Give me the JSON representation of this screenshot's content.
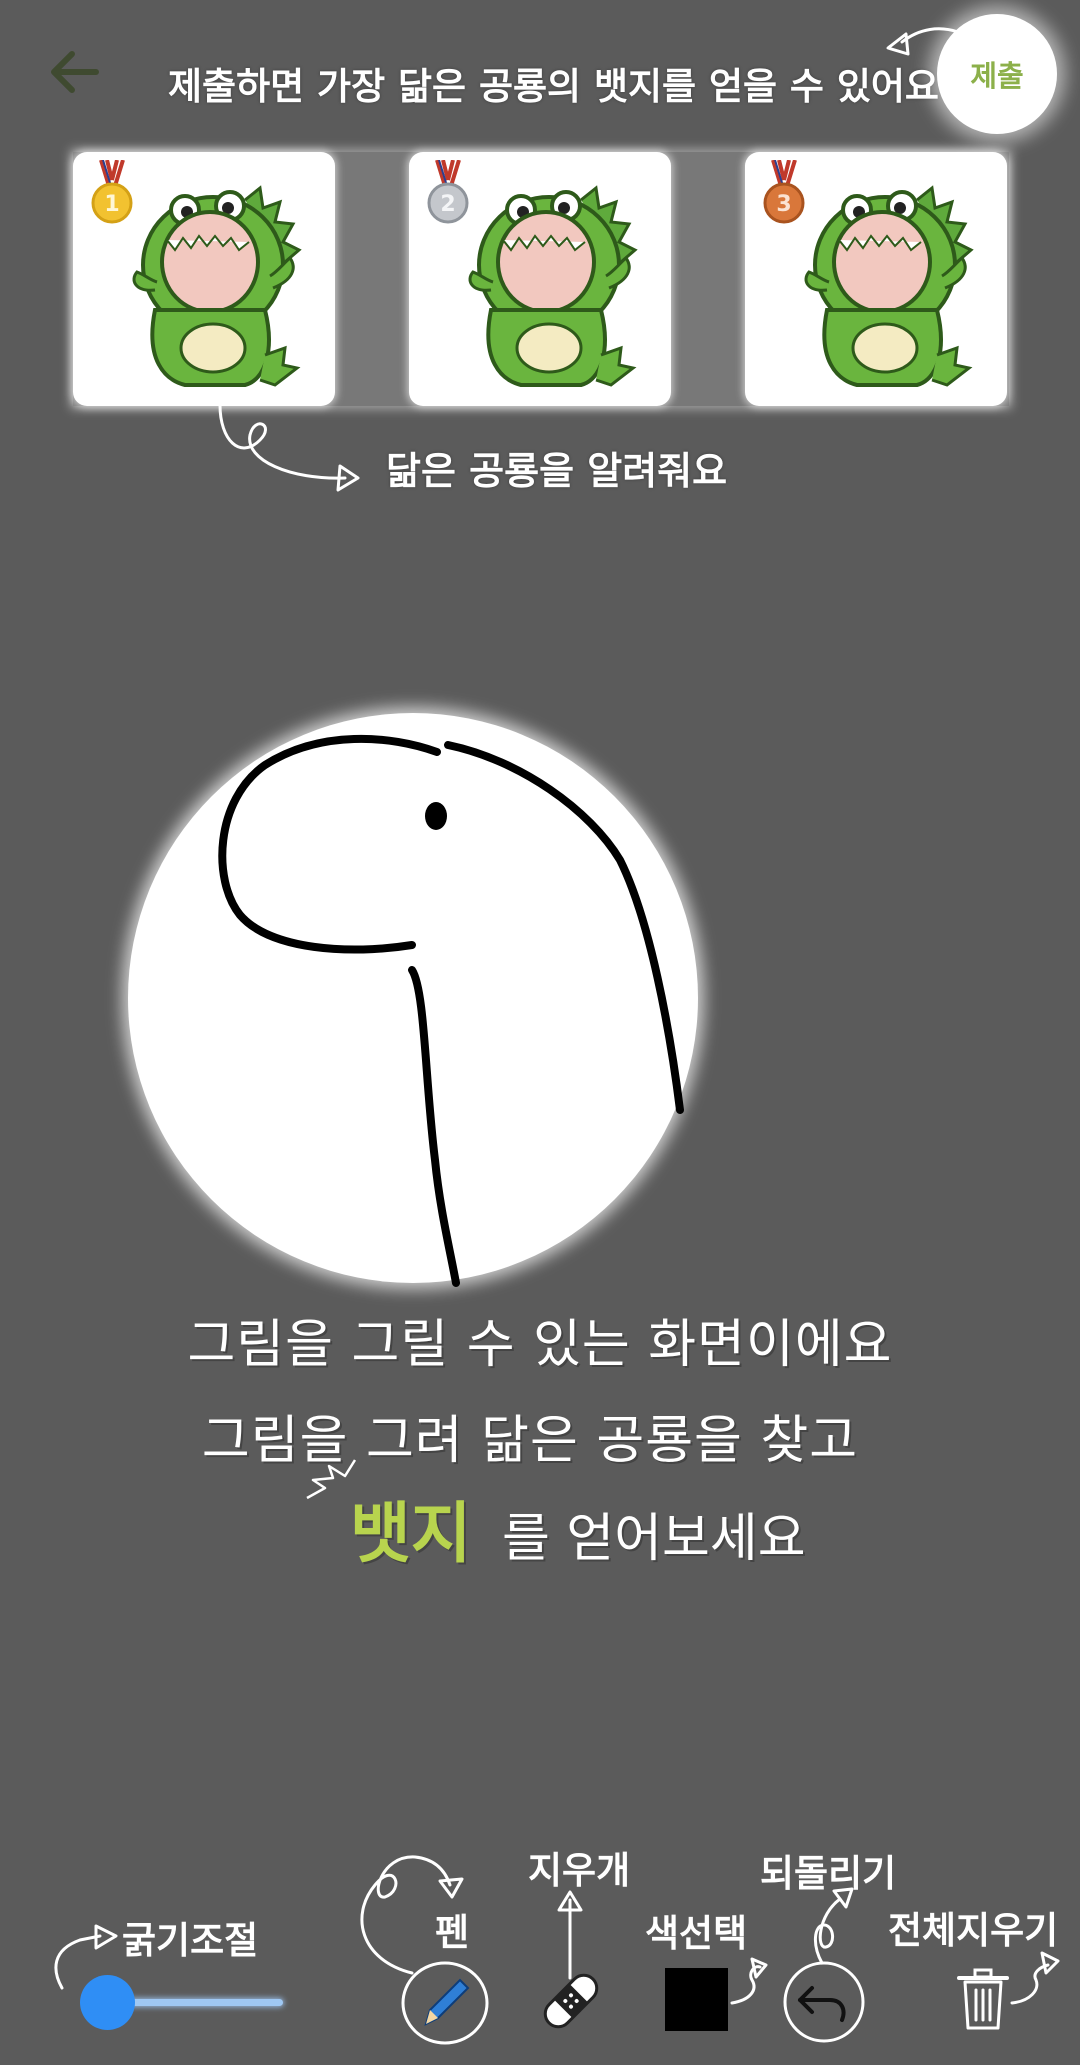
{
  "header": {
    "back_icon": "arrow-left-icon",
    "hint": "제출하면 가장 닮은 공룡의 뱃지를 얻을 수 있어요",
    "submit_label": "제출"
  },
  "ranking": {
    "cards": [
      {
        "medal_number": "1",
        "medal_color": "#f2c230",
        "icon": "dinosaur-costume-icon"
      },
      {
        "medal_number": "2",
        "medal_color": "#c4c7cc",
        "icon": "dinosaur-costume-icon"
      },
      {
        "medal_number": "3",
        "medal_color": "#d9773a",
        "icon": "dinosaur-costume-icon"
      }
    ],
    "hint": "닮은 공룡을 알려줘요"
  },
  "canvas": {
    "background": "#ffffff",
    "stroke_color": "#000000"
  },
  "guide": {
    "line1": "그림을 그릴 수 있는 화면이에요",
    "line2": "그림을 그려 닮은 공룡을 찾고",
    "badge_word": "뱃지",
    "line3_suffix": "를 얻어보세요",
    "badge_color": "#b8d44e"
  },
  "toolbar": {
    "thickness_label": "굵기조절",
    "pen_label": "펜",
    "eraser_label": "지우개",
    "color_label": "색선택",
    "undo_label": "되돌리기",
    "clear_label": "전체지우기",
    "selected_color": "#000000",
    "slider_accent": "#2f8ef5",
    "icons": {
      "pen": "pencil-icon",
      "eraser": "bandage-eraser-icon",
      "undo": "undo-arrow-icon",
      "clear": "trash-icon"
    }
  },
  "colors": {
    "background": "#5b5b5b",
    "submit_text": "#8cb04a"
  }
}
